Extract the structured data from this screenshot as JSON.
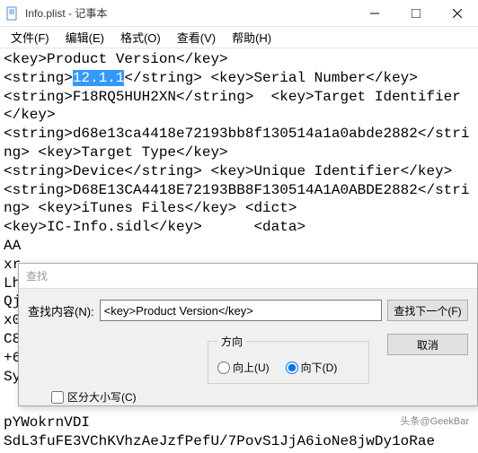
{
  "window": {
    "title": "Info.plist - 记事本"
  },
  "menu": {
    "file": "文件(F)",
    "edit": "编辑(E)",
    "format": "格式(O)",
    "view": "查看(V)",
    "help": "帮助(H)"
  },
  "text": {
    "l1a": "<key>Product Version</key>",
    "l2a": "<string>",
    "l2sel": "12.1.1",
    "l2b": "</string> <key>Serial Number</key>",
    "l3": "<string>F18RQ5HUH2XN</string>  <key>Target Identifier</key>",
    "l4": "<string>d68e13ca4418e72193bb8f130514a1a0abde2882</string> <key>Target Type</key>",
    "l5": "<string>Device</string> <key>Unique Identifier</key>",
    "l6": "<string>D68E13CA4418E72193BB8F130514A1A0ABDE2882</string> <key>iTunes Files</key> <dict>",
    "l7": "<key>IC-Info.sidl</key>      <data>",
    "hidden1": "AA",
    "hidden2": "xr",
    "hidden3": "Lh",
    "hidden4": "Qj",
    "hidden5": "x0",
    "hidden6": "C8",
    "hidden7": "+6",
    "hidden8": "Sy",
    "bottom1": "pYWokrnVDI",
    "bottom2": "SdL3fuFE3VChKVhzAeJzfPefU/7PovS1JjA6ioNe8jwDy1oRae"
  },
  "find": {
    "title": "查找",
    "label": "查找内容(N):",
    "value": "<key>Product Version</key>",
    "next": "查找下一个(F)",
    "cancel": "取消",
    "direction": "方向",
    "up": "向上(U)",
    "down": "向下(D)",
    "matchcase": "区分大小写(C)"
  },
  "watermark": "头条@GeekBar"
}
